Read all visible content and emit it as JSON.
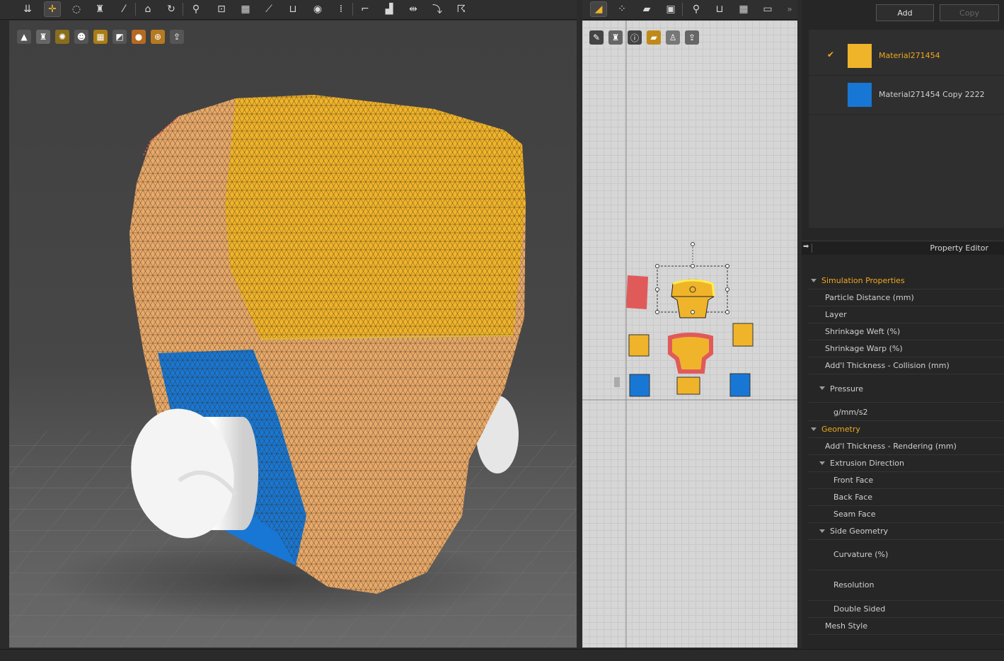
{
  "materials": {
    "add_label": "Add",
    "copy_label": "Copy",
    "items": [
      {
        "name": "Material271454",
        "color": "#f0b42b",
        "selected": true,
        "check": "✔"
      },
      {
        "name": "Material271454 Copy 2222",
        "color": "#1877d4",
        "selected": false
      }
    ]
  },
  "property_editor": {
    "title": "Property Editor",
    "sections": {
      "simulation": "Simulation Properties",
      "geometry": "Geometry"
    },
    "rows": {
      "particle_distance": "Particle Distance (mm)",
      "layer": "Layer",
      "shrinkage_weft": "Shrinkage Weft (%)",
      "shrinkage_warp": "Shrinkage Warp (%)",
      "addl_thickness_collision": "Add'l Thickness - Collision (mm)",
      "pressure": "Pressure",
      "pressure_unit": "g/mm/s2",
      "addl_thickness_rendering": "Add'l Thickness - Rendering (mm)",
      "extrusion_direction": "Extrusion Direction",
      "front_face": "Front Face",
      "back_face": "Back Face",
      "seam_face": "Seam Face",
      "side_geometry": "Side Geometry",
      "curvature": "Curvature (%)",
      "resolution": "Resolution",
      "double_sided": "Double Sided",
      "mesh_style": "Mesh Style"
    }
  },
  "toolbar_3d": {
    "icons": [
      "layers-icon",
      "transform-pin-icon",
      "lasso-icon",
      "garment-icon",
      "wand-icon",
      "avatar-icon",
      "rotate-icon",
      "pin-icon",
      "tack-icon",
      "grid-icon",
      "measure-icon",
      "fold-icon",
      "point-icon",
      "zipper-icon",
      "align-icon",
      "snap-icon",
      "flip-icon",
      "strap-icon",
      "walk-icon"
    ]
  },
  "toolbar_2d": {
    "icons": [
      "select-icon",
      "transform-icon",
      "segment-icon",
      "polygon-icon",
      "pin-icon",
      "fold-icon",
      "grid-icon",
      "iron-icon"
    ],
    "overflow": "»"
  },
  "colors": {
    "accent": "#f0a81e",
    "yellow_fabric": "#f0b42b",
    "blue_fabric": "#1877d4",
    "skin": "#e8a96a"
  }
}
